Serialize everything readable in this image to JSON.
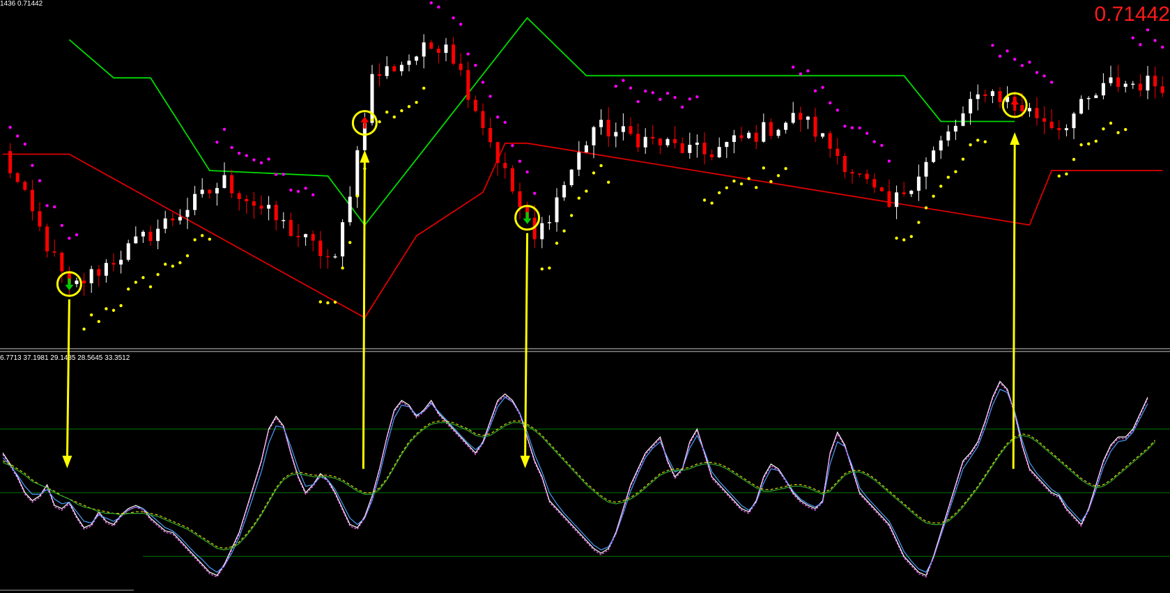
{
  "main_panel": {
    "info_text": "1436 0.71442",
    "current_price": "0.71442"
  },
  "oscillator_panel": {
    "info_text": "6.7713 37.1981 29.1435 28.5645 33.3512"
  },
  "colors": {
    "background": "#000000",
    "bull_candle": "#ffffff",
    "bear_candle": "#ff0000",
    "sar_up": "#ffff00",
    "sar_down": "#ff00ff",
    "channel_upper": "#00dd00",
    "channel_lower": "#dd0000",
    "signal_marker": "#ffff00",
    "arrow_up": "#ff0000",
    "arrow_down": "#00cc00",
    "osc_main": "#ffffff",
    "osc_signal": "#4d9fff",
    "osc_fast": "#ff66ff",
    "osc_slow": "#dddd00",
    "osc_slow2": "#33aa33",
    "level_line": "#007700"
  },
  "chart_data": [
    {
      "type": "candlestick",
      "panel": "main",
      "title": "",
      "trend_segments": [
        {
          "from": 0,
          "to": 9,
          "value": 0.7
        },
        {
          "from": 9,
          "to": 30,
          "value": -0.55
        },
        {
          "from": 30,
          "to": 45,
          "value": 0.45
        },
        {
          "from": 45,
          "to": 50,
          "value": -0.3
        },
        {
          "from": 50,
          "to": 60,
          "value": 1.4
        },
        {
          "from": 60,
          "to": 72,
          "value": 1.75
        },
        {
          "from": 72,
          "to": 80,
          "value": -0.1
        },
        {
          "from": 80,
          "to": 95,
          "value": 0.95
        },
        {
          "from": 95,
          "to": 108,
          "value": 0.7
        },
        {
          "from": 108,
          "to": 120,
          "value": 1.05
        },
        {
          "from": 120,
          "to": 133,
          "value": 0.2
        },
        {
          "from": 133,
          "to": 143,
          "value": 1.3
        },
        {
          "from": 143,
          "to": 150,
          "value": 0.95
        },
        {
          "from": 150,
          "to": 157,
          "value": 1.35
        }
      ],
      "channel_upper": [
        [
          9,
          1.75
        ],
        [
          15,
          1.4
        ],
        [
          20,
          1.4
        ],
        [
          28,
          0.55
        ],
        [
          44,
          0.5
        ],
        [
          49,
          0.05
        ],
        [
          71,
          1.95
        ],
        [
          79,
          1.42
        ],
        [
          122,
          1.42
        ],
        [
          127,
          1.0
        ],
        [
          137,
          1.0
        ]
      ],
      "channel_lower": [
        [
          0,
          0.7
        ],
        [
          9,
          0.7
        ],
        [
          49,
          -0.8
        ],
        [
          56,
          -0.05
        ],
        [
          65,
          0.35
        ],
        [
          68,
          0.8
        ],
        [
          71,
          0.8
        ],
        [
          139,
          0.05
        ],
        [
          142,
          0.55
        ],
        [
          157,
          0.55
        ]
      ],
      "signals": [
        {
          "index": 9,
          "direction": "down"
        },
        {
          "index": 49,
          "direction": "up"
        },
        {
          "index": 71,
          "direction": "down"
        },
        {
          "index": 137,
          "direction": "up"
        }
      ]
    },
    {
      "type": "line",
      "panel": "oscillator",
      "title": "",
      "series": [
        {
          "name": "",
          "values": [
            55,
            48,
            40,
            30,
            25,
            28,
            35,
            22,
            20,
            24,
            15,
            8,
            10,
            18,
            12,
            10,
            16,
            20,
            22,
            20,
            14,
            10,
            6,
            5,
            0,
            -5,
            -10,
            -15,
            -20,
            -22,
            -15,
            -5,
            5,
            20,
            35,
            50,
            70,
            78,
            72,
            55,
            40,
            30,
            35,
            42,
            38,
            30,
            20,
            10,
            8,
            15,
            28,
            45,
            65,
            82,
            88,
            85,
            78,
            82,
            88,
            80,
            75,
            70,
            65,
            60,
            55,
            62,
            75,
            88,
            92,
            88,
            80,
            65,
            50,
            40,
            25,
            20,
            15,
            10,
            5,
            0,
            -5,
            -8,
            -5,
            5,
            20,
            35,
            45,
            55,
            60,
            65,
            50,
            40,
            45,
            62,
            70,
            55,
            40,
            35,
            30,
            25,
            20,
            18,
            25,
            40,
            48,
            45,
            38,
            30,
            25,
            22,
            20,
            25,
            55,
            68,
            60,
            45,
            30,
            25,
            20,
            15,
            10,
            0,
            -10,
            -15,
            -20,
            -22,
            -10,
            5,
            20,
            35,
            50,
            55,
            62,
            75,
            90,
            100,
            95,
            80,
            60,
            45,
            40,
            35,
            30,
            28,
            20,
            15,
            10,
            20,
            35,
            50,
            60,
            65,
            65,
            70,
            80,
            90
          ]
        },
        {
          "name": "",
          "values": [
            52,
            47,
            41,
            34,
            29,
            29,
            32,
            26,
            23,
            24,
            18,
            12,
            11,
            16,
            14,
            12,
            15,
            19,
            21,
            20,
            16,
            12,
            8,
            6,
            2,
            -3,
            -8,
            -12,
            -17,
            -20,
            -16,
            -8,
            2,
            15,
            29,
            43,
            61,
            72,
            71,
            59,
            45,
            34,
            35,
            40,
            38,
            32,
            23,
            14,
            10,
            14,
            25,
            41,
            60,
            77,
            85,
            84,
            79,
            81,
            86,
            81,
            76,
            71,
            66,
            61,
            57,
            61,
            72,
            84,
            90,
            87,
            80,
            68,
            54,
            43,
            30,
            23,
            17,
            12,
            7,
            2,
            -3,
            -6,
            -4,
            4,
            17,
            31,
            42,
            52,
            58,
            62,
            52,
            43,
            45,
            58,
            66,
            56,
            43,
            37,
            32,
            27,
            22,
            19,
            24,
            36,
            45,
            44,
            38,
            31,
            26,
            23,
            21,
            24,
            48,
            62,
            59,
            47,
            33,
            27,
            22,
            17,
            12,
            3,
            -7,
            -13,
            -18,
            -20,
            -11,
            3,
            17,
            31,
            45,
            52,
            59,
            71,
            85,
            95,
            93,
            81,
            63,
            49,
            42,
            37,
            32,
            29,
            22,
            17,
            12,
            19,
            32,
            46,
            56,
            62,
            63,
            68,
            77,
            86
          ]
        },
        {
          "name": "",
          "values": [
            54,
            47,
            39,
            29,
            24,
            27,
            34,
            21,
            19,
            23,
            14,
            7,
            9,
            17,
            11,
            9,
            15,
            19,
            21,
            19,
            13,
            9,
            5,
            4,
            -1,
            -6,
            -11,
            -16,
            -21,
            -23,
            -16,
            -6,
            4,
            19,
            34,
            49,
            69,
            77,
            71,
            54,
            39,
            29,
            34,
            41,
            37,
            29,
            19,
            9,
            7,
            14,
            27,
            44,
            64,
            81,
            87,
            84,
            77,
            81,
            87,
            79,
            74,
            69,
            64,
            59,
            54,
            61,
            74,
            87,
            91,
            87,
            79,
            64,
            49,
            39,
            24,
            19,
            14,
            9,
            4,
            -1,
            -6,
            -9,
            -6,
            4,
            19,
            34,
            44,
            54,
            59,
            64,
            49,
            39,
            44,
            61,
            69,
            54,
            39,
            34,
            29,
            24,
            19,
            17,
            24,
            39,
            47,
            44,
            37,
            29,
            24,
            21,
            19,
            24,
            54,
            67,
            59,
            44,
            29,
            24,
            19,
            14,
            9,
            -1,
            -11,
            -16,
            -21,
            -23,
            -11,
            4,
            19,
            34,
            49,
            54,
            61,
            74,
            89,
            99,
            94,
            79,
            59,
            44,
            39,
            34,
            29,
            27,
            19,
            14,
            9,
            19,
            34,
            49,
            59,
            64,
            64,
            69,
            79,
            89
          ]
        },
        {
          "name": "",
          "values": [
            50,
            48,
            45,
            42,
            38,
            35,
            33,
            31,
            28,
            26,
            24,
            22,
            20,
            19,
            18,
            17,
            17,
            17,
            18,
            18,
            17,
            16,
            14,
            12,
            10,
            8,
            5,
            2,
            -1,
            -4,
            -5,
            -4,
            -1,
            4,
            10,
            17,
            25,
            33,
            39,
            42,
            43,
            42,
            41,
            41,
            41,
            40,
            38,
            35,
            32,
            30,
            30,
            33,
            39,
            47,
            55,
            62,
            67,
            71,
            74,
            75,
            75,
            74,
            72,
            70,
            67,
            66,
            67,
            70,
            73,
            75,
            75,
            73,
            70,
            66,
            61,
            56,
            51,
            46,
            41,
            36,
            32,
            28,
            25,
            24,
            25,
            27,
            30,
            34,
            38,
            42,
            44,
            45,
            45,
            46,
            48,
            49,
            49,
            48,
            46,
            43,
            40,
            37,
            34,
            32,
            32,
            33,
            34,
            35,
            35,
            34,
            32,
            30,
            32,
            37,
            42,
            44,
            44,
            42,
            39,
            35,
            31,
            27,
            23,
            19,
            15,
            12,
            11,
            11,
            13,
            17,
            22,
            28,
            34,
            41,
            48,
            55,
            61,
            65,
            67,
            66,
            63,
            59,
            55,
            51,
            47,
            43,
            39,
            36,
            34,
            35,
            38,
            42,
            46,
            50,
            54,
            58,
            63
          ]
        },
        {
          "name": "",
          "values": [
            49,
            47,
            44,
            41,
            37,
            35,
            33,
            30,
            28,
            26,
            23,
            21,
            20,
            18,
            17,
            17,
            16,
            17,
            17,
            17,
            16,
            15,
            13,
            11,
            9,
            7,
            4,
            1,
            -2,
            -5,
            -6,
            -5,
            -2,
            3,
            9,
            16,
            24,
            32,
            38,
            41,
            42,
            41,
            40,
            40,
            40,
            39,
            37,
            34,
            31,
            29,
            29,
            32,
            38,
            46,
            54,
            61,
            66,
            70,
            73,
            74,
            74,
            73,
            71,
            69,
            66,
            65,
            66,
            69,
            72,
            74,
            74,
            72,
            69,
            65,
            60,
            55,
            50,
            45,
            40,
            35,
            31,
            27,
            24,
            23,
            24,
            26,
            29,
            33,
            37,
            41,
            43,
            44,
            44,
            45,
            47,
            48,
            48,
            47,
            45,
            42,
            39,
            36,
            33,
            31,
            31,
            32,
            33,
            34,
            34,
            33,
            31,
            29,
            31,
            36,
            41,
            43,
            43,
            41,
            38,
            34,
            30,
            26,
            22,
            18,
            14,
            11,
            10,
            10,
            12,
            16,
            21,
            27,
            33,
            40,
            47,
            54,
            60,
            64,
            66,
            65,
            62,
            58,
            54,
            50,
            46,
            42,
            38,
            35,
            33,
            34,
            37,
            41,
            45,
            49,
            53,
            57,
            62
          ]
        }
      ],
      "levels": [
        70,
        30,
        -10
      ],
      "ylim": [
        -30,
        110
      ]
    }
  ]
}
